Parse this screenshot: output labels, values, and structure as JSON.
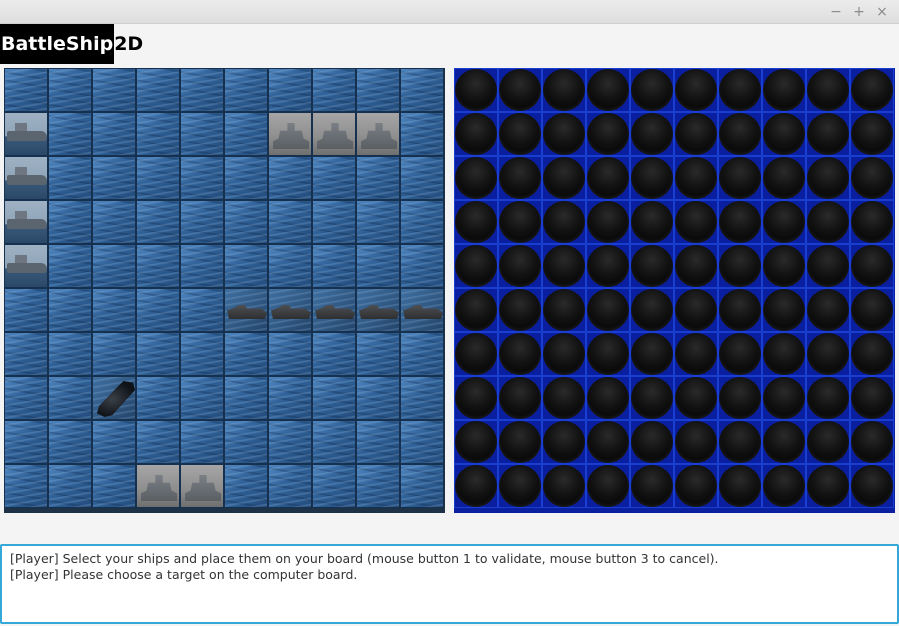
{
  "window": {
    "controls": {
      "minimize": "−",
      "maximize": "+",
      "close": "×"
    }
  },
  "header": {
    "logo_part1": "BattleShip",
    "logo_part2": "2D"
  },
  "player_board": {
    "rows": 10,
    "cols": 10,
    "cells": [
      [
        "water",
        "water",
        "water",
        "water",
        "water",
        "water",
        "water",
        "water",
        "water",
        "water"
      ],
      [
        "ship-sea",
        "water",
        "water",
        "water",
        "water",
        "water",
        "ship-grey",
        "ship-grey",
        "ship-grey",
        "water"
      ],
      [
        "ship-sea",
        "water",
        "water",
        "water",
        "water",
        "water",
        "water",
        "water",
        "water",
        "water"
      ],
      [
        "ship-sea",
        "water",
        "water",
        "water",
        "water",
        "water",
        "water",
        "water",
        "water",
        "water"
      ],
      [
        "ship-sea",
        "water",
        "water",
        "water",
        "water",
        "water",
        "water",
        "water",
        "water",
        "water"
      ],
      [
        "water",
        "water",
        "water",
        "water",
        "water",
        "ship-dark",
        "ship-dark",
        "ship-dark",
        "ship-dark",
        "ship-dark"
      ],
      [
        "water",
        "water",
        "water",
        "water",
        "water",
        "water",
        "water",
        "water",
        "water",
        "water"
      ],
      [
        "water",
        "water",
        "sub",
        "water",
        "water",
        "water",
        "water",
        "water",
        "water",
        "water"
      ],
      [
        "water",
        "water",
        "water",
        "water",
        "water",
        "water",
        "water",
        "water",
        "water",
        "water"
      ],
      [
        "water",
        "water",
        "water",
        "ship-grey",
        "ship-grey",
        "water",
        "water",
        "water",
        "water",
        "water"
      ]
    ]
  },
  "computer_board": {
    "rows": 10,
    "cols": 10,
    "cell_state": "unknown"
  },
  "console": {
    "lines": [
      "[Player] Select your ships and place them on your board (mouse button 1 to validate, mouse button 3 to cancel).",
      "[Player] Please choose a target on the computer board."
    ]
  },
  "colors": {
    "accent_border": "#35a8d8",
    "computer_grid": "#0a20a0",
    "water": "#2e5f95"
  }
}
